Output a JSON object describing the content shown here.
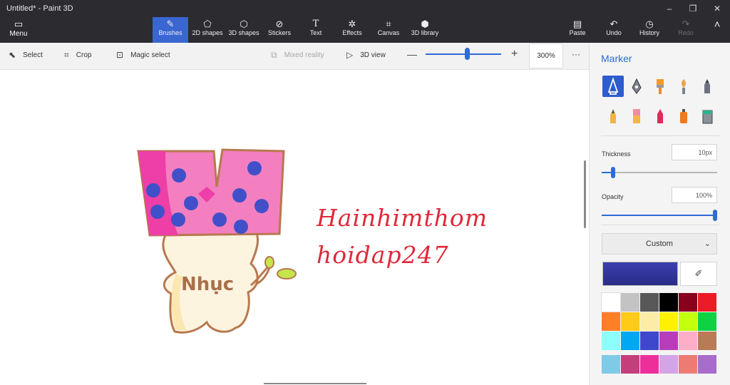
{
  "window": {
    "title": "Untitled* - Paint 3D",
    "min": "–",
    "restore": "❐",
    "close": "✕"
  },
  "ribbon": {
    "menu": {
      "label": "Menu",
      "icon": "folder-icon"
    },
    "tools": [
      {
        "label": "Brushes",
        "icon": "brush-icon",
        "active": true
      },
      {
        "label": "2D shapes",
        "icon": "2d-shapes-icon"
      },
      {
        "label": "3D shapes",
        "icon": "3d-shapes-icon"
      },
      {
        "label": "Stickers",
        "icon": "sticker-icon"
      },
      {
        "label": "Text",
        "icon": "text-icon"
      },
      {
        "label": "Effects",
        "icon": "effects-icon"
      },
      {
        "label": "Canvas",
        "icon": "canvas-icon"
      },
      {
        "label": "3D library",
        "icon": "library-icon"
      }
    ],
    "right": [
      {
        "label": "Paste",
        "icon": "paste-icon"
      },
      {
        "label": "Undo",
        "icon": "undo-icon"
      },
      {
        "label": "History",
        "icon": "history-icon"
      },
      {
        "label": "Redo",
        "icon": "redo-icon",
        "disabled": true
      }
    ]
  },
  "toolbar": {
    "select": "Select",
    "crop": "Crop",
    "magic_select": "Magic select",
    "mixed_reality": "Mixed reality",
    "view_3d": "3D view",
    "zoom_minus": "—",
    "zoom_plus": "+",
    "zoom": "300%",
    "zoom_level": 0.55,
    "more": "···"
  },
  "canvas": {
    "text_line1": "Hainhimthom",
    "text_line2": "hoidap247",
    "shirt_text": "Nhục",
    "text_color": "#e0283a"
  },
  "panel": {
    "title": "Marker",
    "thickness_label": "Thickness",
    "thickness_value": "10px",
    "thickness_level": 0.1,
    "opacity_label": "Opacity",
    "opacity_value": "100%",
    "opacity_level": 1.0,
    "color_mode": "Custom",
    "current_color": "#3a3fb0",
    "accent": "#2d6bd6",
    "palette": [
      "#ffffff",
      "#c3c3c3",
      "#585858",
      "#000000",
      "#88001b",
      "#ec1c24",
      "#ff7f27",
      "#ffca18",
      "#fdeca6",
      "#fff200",
      "#c4ff0e",
      "#0ed145",
      "#8cfffb",
      "#00a8f3",
      "#3f48cc",
      "#b83dba",
      "#ffaec8",
      "#b97a56",
      "#7ecbe8",
      "#c43e7c",
      "#ed2f9b",
      "#d4a5e6",
      "#ee7a74",
      "#a86ccb"
    ]
  }
}
